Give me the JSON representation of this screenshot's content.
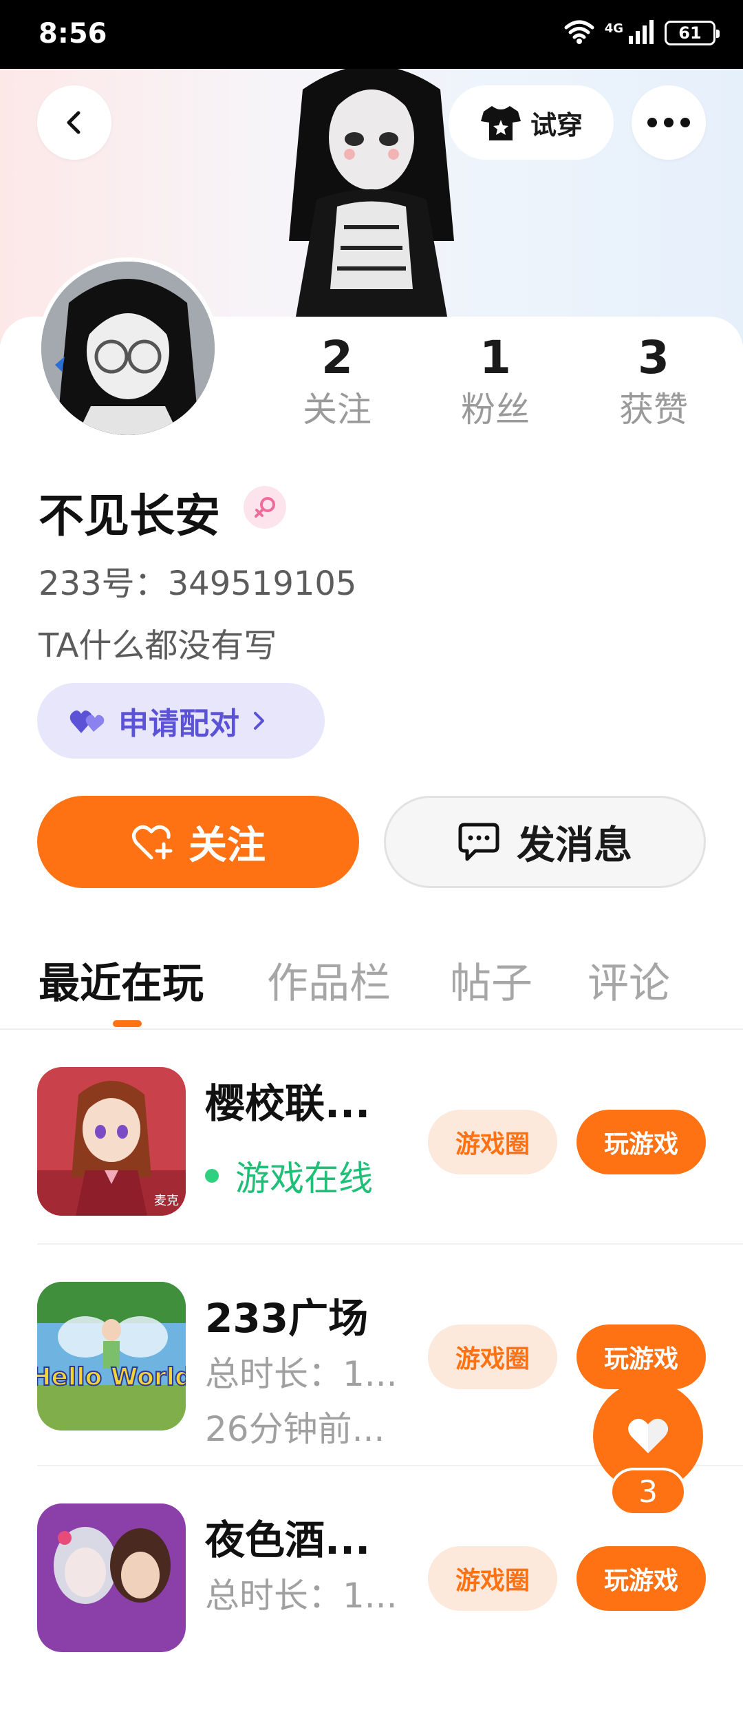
{
  "status_bar": {
    "time": "8:56",
    "network": "4G",
    "battery": "61"
  },
  "header": {
    "try_on_label": "试穿"
  },
  "profile": {
    "name": "不见长安",
    "uid": "233号：349519105",
    "bio": "TA什么都没有写",
    "stats": [
      {
        "value": "2",
        "label": "关注"
      },
      {
        "value": "1",
        "label": "粉丝"
      },
      {
        "value": "3",
        "label": "获赞"
      }
    ],
    "pair_label": "申请配对",
    "follow_label": "关注",
    "message_label": "发消息"
  },
  "tabs": [
    {
      "label": "最近在玩",
      "active": true
    },
    {
      "label": "作品栏",
      "active": false
    },
    {
      "label": "帖子",
      "active": false
    },
    {
      "label": "评论",
      "active": false
    }
  ],
  "games": [
    {
      "title": "樱校联...",
      "line1": "游戏在线",
      "line2": "",
      "circle_label": "游戏圈",
      "play_label": "玩游戏",
      "icon_text": "麦克"
    },
    {
      "title": "233广场",
      "line1": "总时长：1...",
      "line2": "26分钟前...",
      "circle_label": "游戏圈",
      "play_label": "玩游戏",
      "icon_text": "Hello World"
    },
    {
      "title": "夜色酒...",
      "line1": "总时长：1...",
      "line2": "",
      "circle_label": "游戏圈",
      "play_label": "玩游戏",
      "icon_text": ""
    }
  ],
  "like_fab": {
    "count": "3"
  },
  "colors": {
    "accent": "#ff7214",
    "online": "#1fbf77",
    "pair": "#5b52d6"
  }
}
